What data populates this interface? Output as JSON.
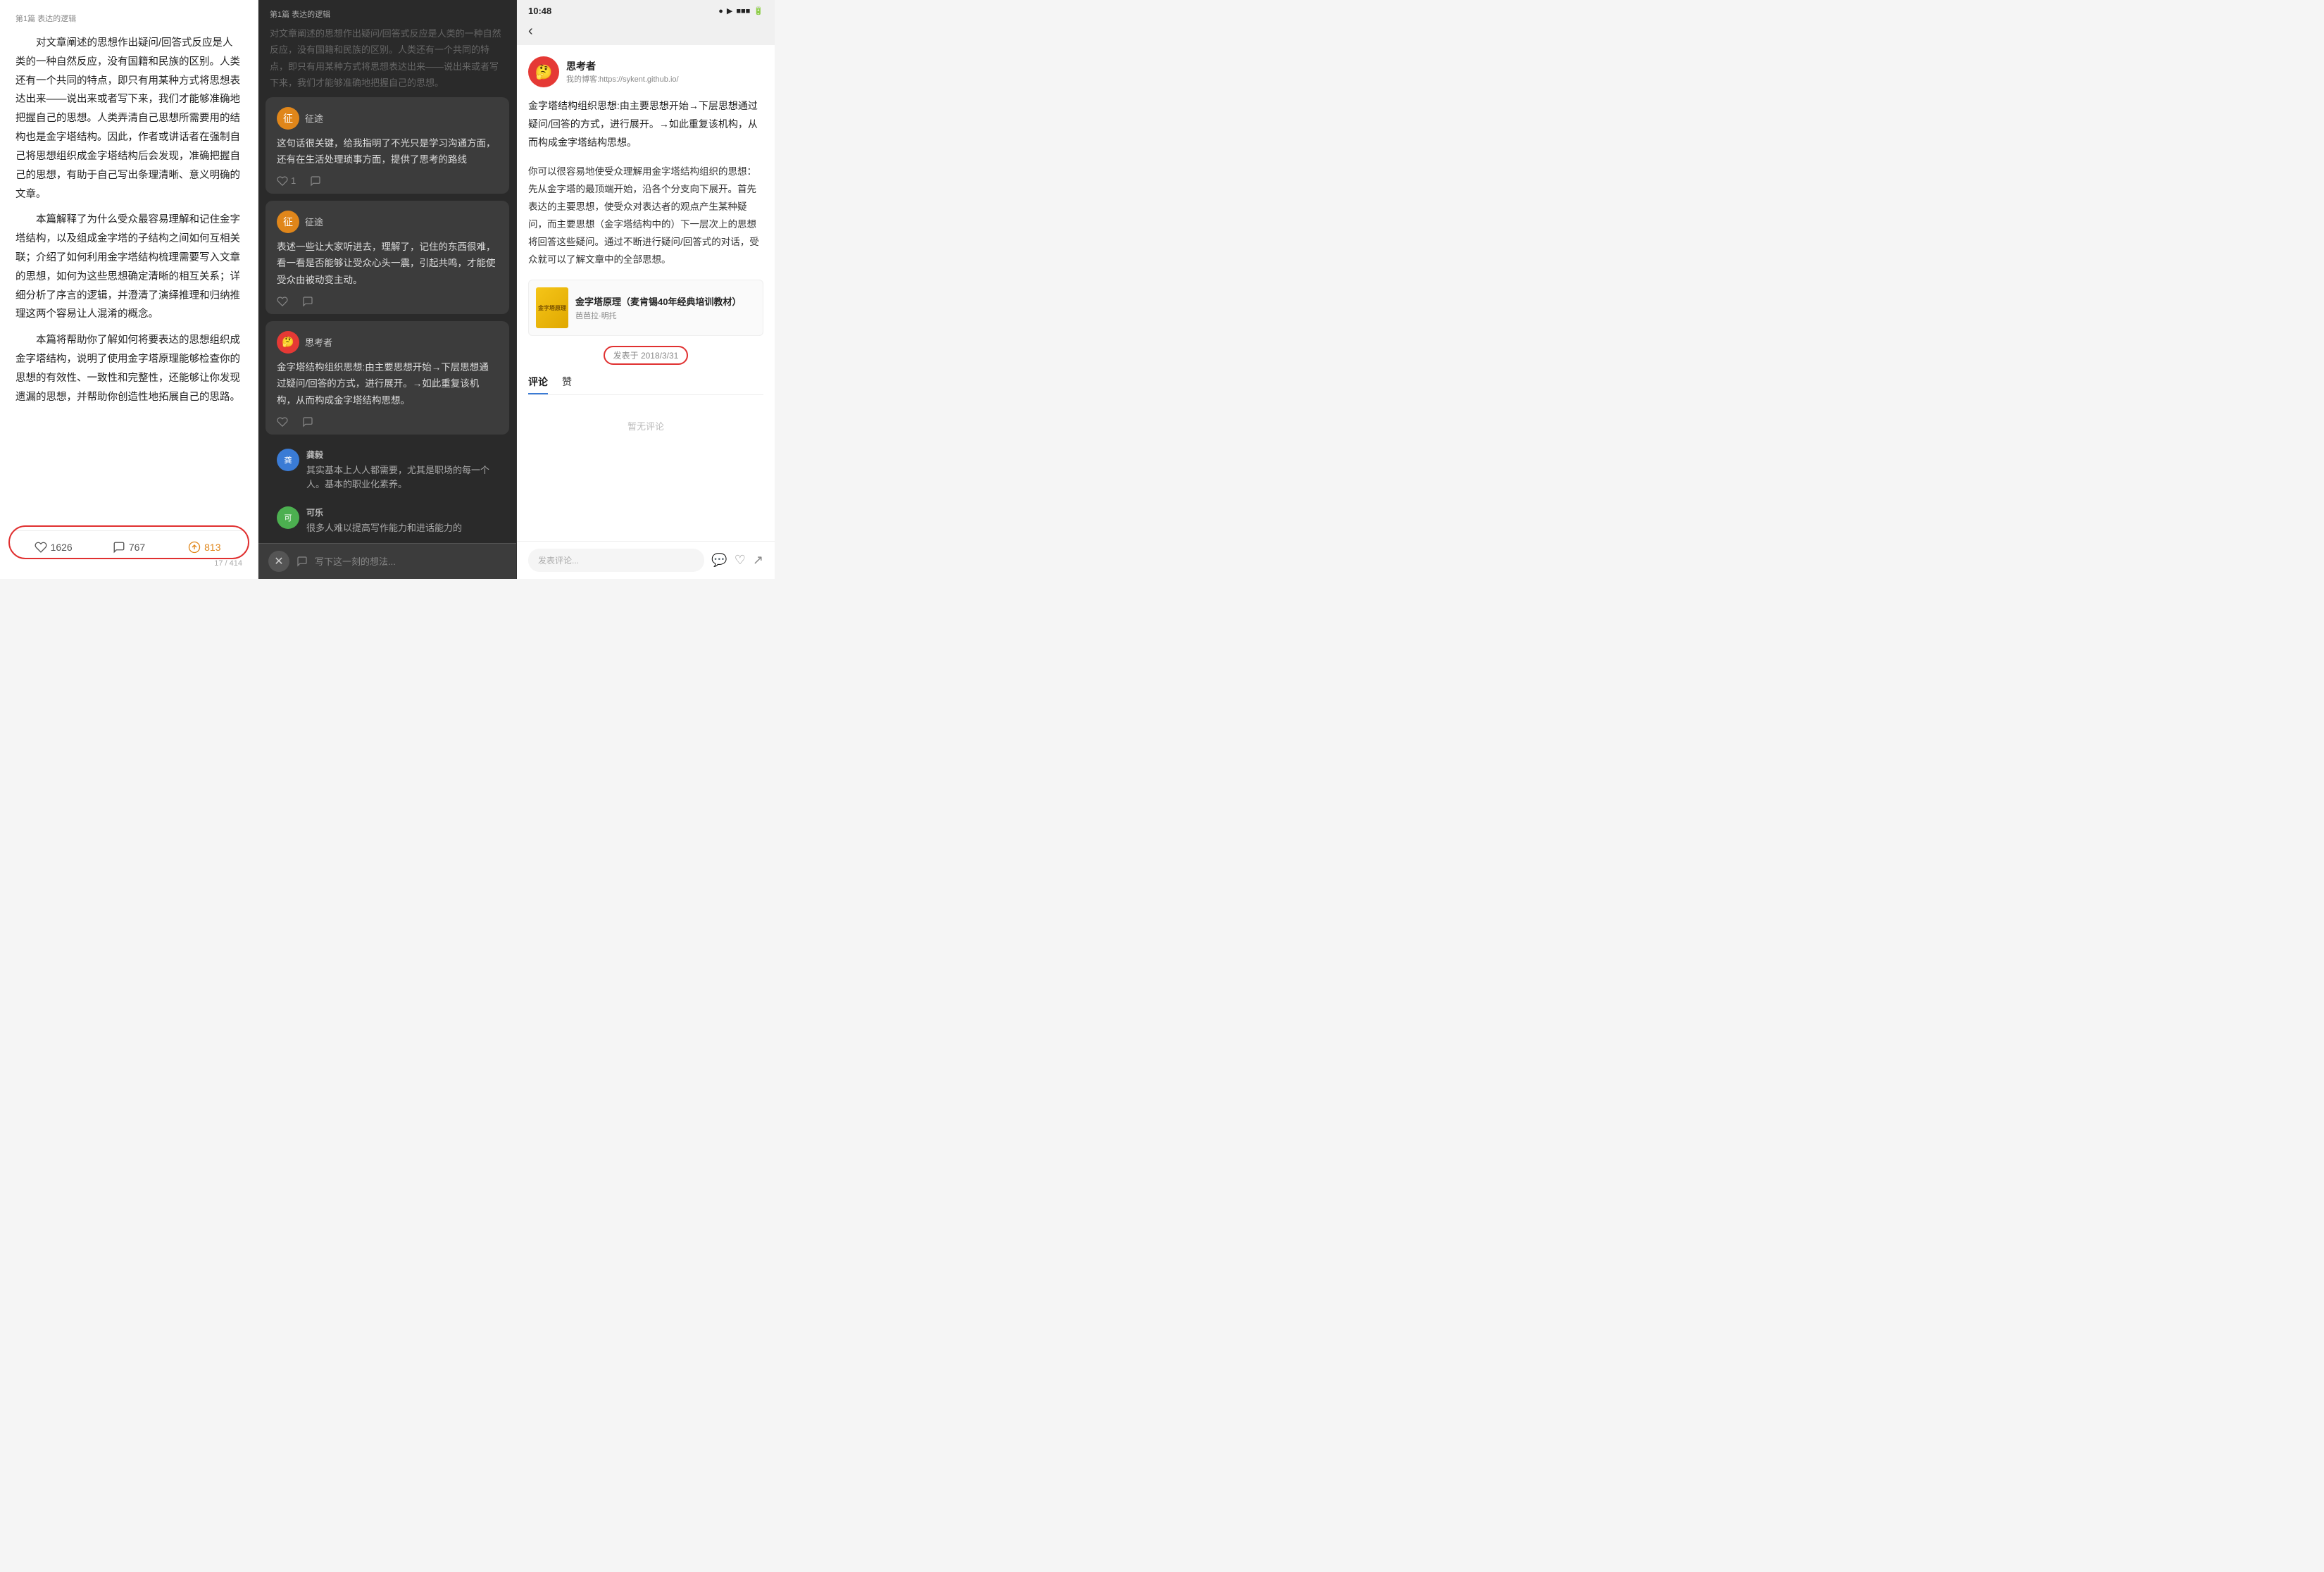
{
  "left": {
    "breadcrumb": "第1篇 表达的逻辑",
    "paragraphs": [
      "对文章阐述的思想作出疑问/回答式反应是人类的一种自然反应，没有国籍和民族的区别。人类还有一个共同的特点，即只有用某种方式将思想表达出来——说出来或者写下来，我们才能够准确地把握自己的思想。人类弄清自己思想所需要用的结构也是金字塔结构。因此，作者或讲话者在强制自己将思想组织成金字塔结构后会发现，准确把握自己的思想，有助于自己写出条理清晰、意义明确的文章。",
      "本篇解释了为什么受众最容易理解和记住金字塔结构，以及组成金字塔的子结构之间如何互相关联；介绍了如何利用金字塔结构梳理需要写入文章的思想，如何为这些思想确定清晰的相互关系；详细分析了序言的逻辑，并澄清了演绎推理和归纳推理这两个容易让人混淆的概念。",
      "本篇将帮助你了解如何将要表达的思想组织成金字塔结构，说明了使用金字塔原理能够检查你的思想的有效性、一致性和完整性，还能够让你发现遗漏的思想，并帮助你创造性地拓展自己的思路。"
    ],
    "footer": {
      "likes": "1626",
      "comments": "767",
      "shares": "813"
    },
    "page_indicator": "17 / 414"
  },
  "mid": {
    "breadcrumb": "第1篇 表达的逻辑",
    "bg_text": "对文章阐述的思想作出疑问/回答式反应是人类的一种自然反应，没有国籍和民族的区别。人类还有一个共同的特点，即只有用某种方式将思想表达出来——说出来或者写下来，我们才能够准确地把握自己的思想。",
    "comments": [
      {
        "id": "c1",
        "name": "征途",
        "avatar_char": "征",
        "avatar_color": "orange",
        "text": "这句话很关键，给我指明了不光只是学习沟通方面，还有在生活处理琐事方面，提供了思考的路线",
        "likes": "1",
        "has_reply": true
      },
      {
        "id": "c2",
        "name": "征途",
        "avatar_char": "征",
        "avatar_color": "orange",
        "text": "表述一些让大家听进去，理解了，记住的东西很难，看一看是否能够让受众心头一震，引起共鸣，才能使受众由被动变主动。",
        "likes": "",
        "has_reply": true
      },
      {
        "id": "c3",
        "name": "思考者",
        "avatar_char": "🤔",
        "avatar_color": "red",
        "text": "金字塔结构组织思想:由主要思想开始→下层思想通过疑问/回答的方式，进行展开。→如此重复该机构，从而构成金字塔结构思想。",
        "likes": "",
        "has_reply": true
      }
    ],
    "input_placeholder": "写下这一刻的想法...",
    "bottom_comment": {
      "name": "龚毅",
      "avatar_char": "龚",
      "avatar_color": "blue",
      "text": "其实基本上人人都需要，尤其是职场的每一个人。基本的职业化素养。"
    },
    "bottom_comment2": {
      "name": "可乐",
      "avatar_char": "可",
      "avatar_color": "green",
      "text": "很多人难以提高写作能力和进话能力的"
    }
  },
  "right": {
    "status_bar": {
      "time": "10:48",
      "icons": "● □ ▶ ■ ■ ■"
    },
    "author": {
      "name": "思考者",
      "blog": "我的博客:https://sykent.github.io/",
      "avatar_char": "🤔"
    },
    "main_note": "金字塔结构组织思想:由主要思想开始→下层思想通过疑问/回答的方式，进行展开。→如此重复该机构，从而构成金字塔结构思想。",
    "sub_note": "你可以很容易地使受众理解用金字塔结构组织的思想：先从金字塔的最顶端开始，沿各个分支向下展开。首先表达的主要思想，使受众对表达者的观点产生某种疑问，而主要思想（金字塔结构中的）下一层次上的思想将回答这些疑问。通过不断进行疑问/回答式的对话，受众就可以了解文章中的全部思想。",
    "book": {
      "title": "金字塔原理（麦肯锡40年经典培训教材）",
      "author": "芭芭拉·明托",
      "cover_text": "金字塔原理"
    },
    "publish_date": "发表于 2018/3/31",
    "tabs": [
      "评论",
      "赞"
    ],
    "active_tab": "评论",
    "no_comment": "暂无评论",
    "bottom_bar": {
      "input_placeholder": "发表评论...",
      "comment_icon": "💬",
      "like_icon": "♡",
      "share_icon": "↗"
    }
  }
}
